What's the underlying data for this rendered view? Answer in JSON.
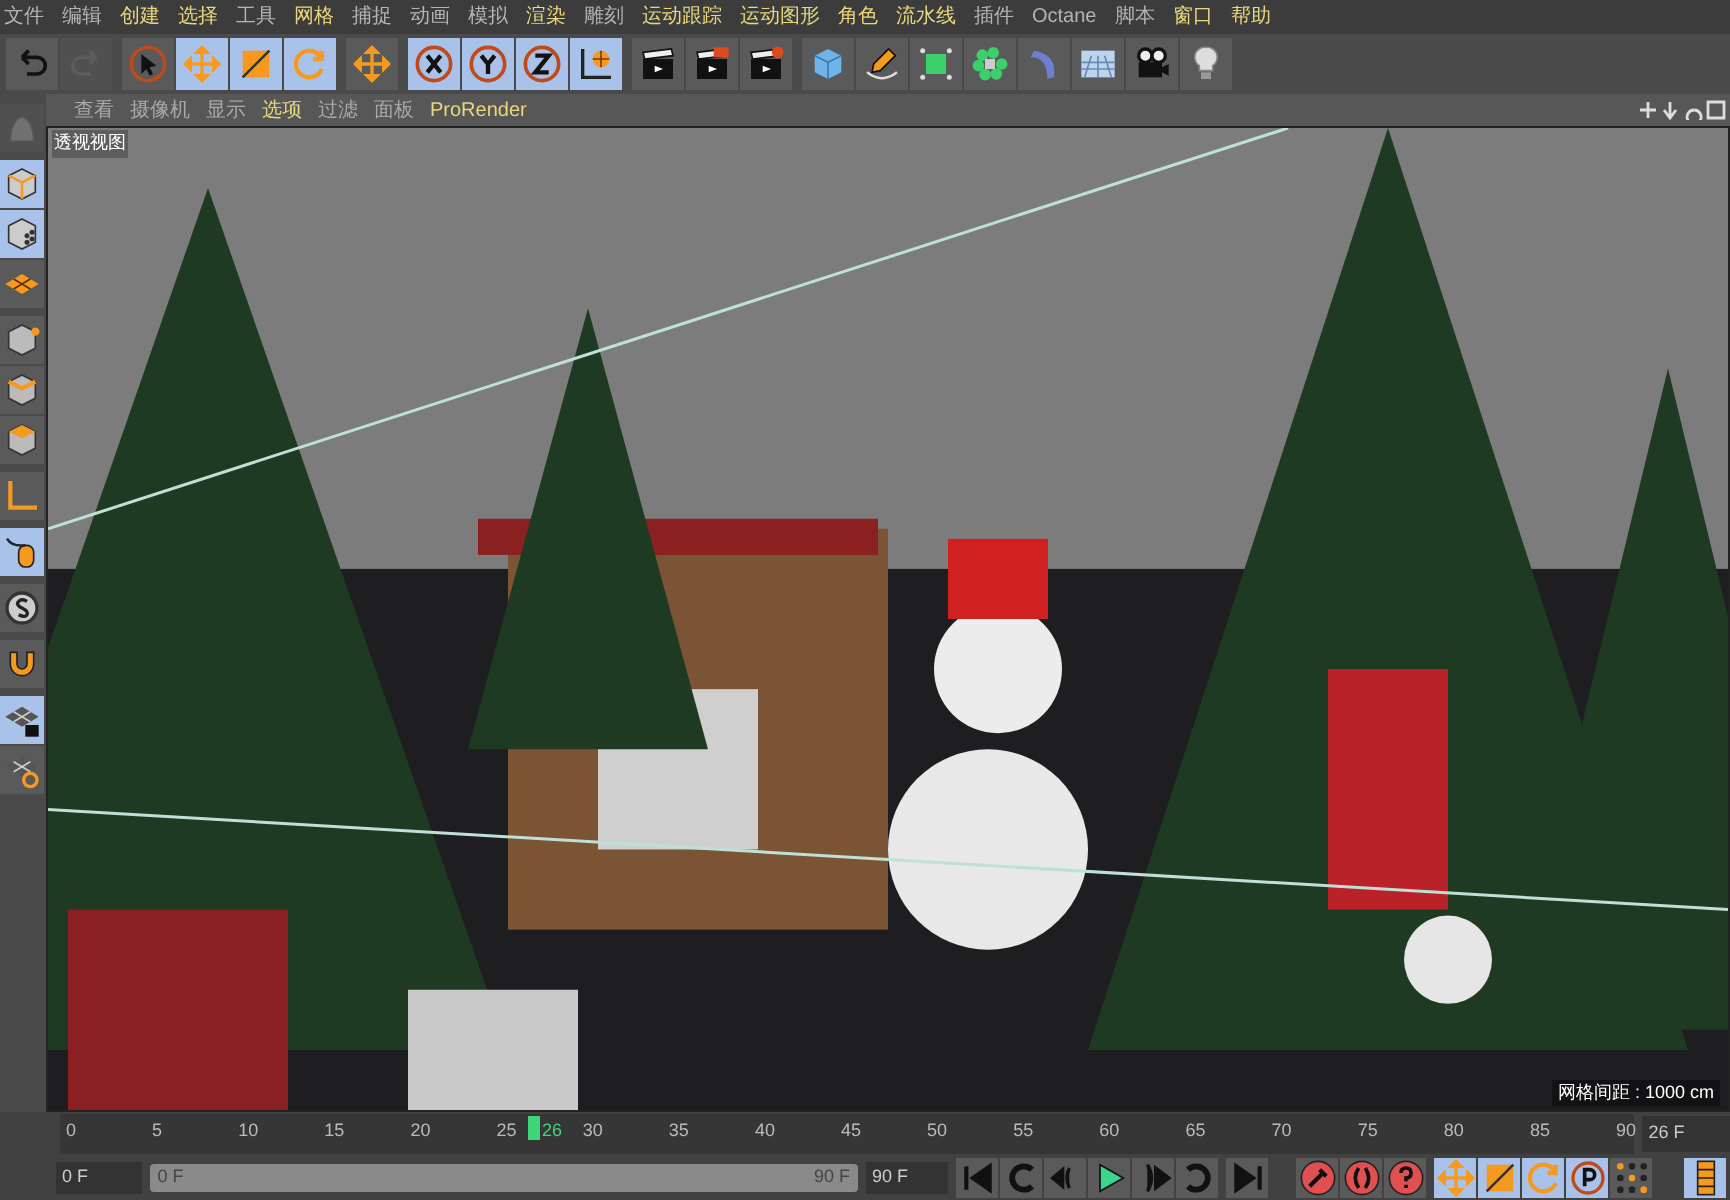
{
  "menu": [
    {
      "label": "文件",
      "highlight": false
    },
    {
      "label": "编辑",
      "highlight": false
    },
    {
      "label": "创建",
      "highlight": true
    },
    {
      "label": "选择",
      "highlight": true
    },
    {
      "label": "工具",
      "highlight": false
    },
    {
      "label": "网格",
      "highlight": true
    },
    {
      "label": "捕捉",
      "highlight": false
    },
    {
      "label": "动画",
      "highlight": false
    },
    {
      "label": "模拟",
      "highlight": false
    },
    {
      "label": "渲染",
      "highlight": true
    },
    {
      "label": "雕刻",
      "highlight": false
    },
    {
      "label": "运动跟踪",
      "highlight": true
    },
    {
      "label": "运动图形",
      "highlight": true
    },
    {
      "label": "角色",
      "highlight": true
    },
    {
      "label": "流水线",
      "highlight": true
    },
    {
      "label": "插件",
      "highlight": false
    },
    {
      "label": "Octane",
      "highlight": false
    },
    {
      "label": "脚本",
      "highlight": false
    },
    {
      "label": "窗口",
      "highlight": true
    },
    {
      "label": "帮助",
      "highlight": true
    }
  ],
  "toolbar": [
    {
      "items": [
        {
          "kind": "undo",
          "selected": false,
          "disabled": false
        },
        {
          "kind": "redo",
          "selected": false,
          "disabled": true
        }
      ]
    },
    {
      "items": [
        {
          "kind": "select",
          "selected": false,
          "disabled": false
        },
        {
          "kind": "move",
          "selected": true,
          "disabled": false
        },
        {
          "kind": "scale",
          "selected": true,
          "disabled": false
        },
        {
          "kind": "rotate",
          "selected": true,
          "disabled": false
        }
      ]
    },
    {
      "items": [
        {
          "kind": "move",
          "selected": false,
          "disabled": false
        }
      ]
    },
    {
      "items": [
        {
          "kind": "x",
          "selected": true,
          "disabled": false
        },
        {
          "kind": "y",
          "selected": true,
          "disabled": false
        },
        {
          "kind": "z",
          "selected": true,
          "disabled": false
        },
        {
          "kind": "coords",
          "selected": true,
          "disabled": false
        }
      ]
    },
    {
      "items": [
        {
          "kind": "render",
          "selected": false,
          "disabled": false
        },
        {
          "kind": "render-view",
          "selected": false,
          "disabled": false
        },
        {
          "kind": "render-settings",
          "selected": false,
          "disabled": false
        }
      ]
    },
    {
      "items": [
        {
          "kind": "cube",
          "selected": false,
          "disabled": false
        },
        {
          "kind": "pen",
          "selected": false,
          "disabled": false
        },
        {
          "kind": "green-cube",
          "selected": false,
          "disabled": false
        },
        {
          "kind": "cloner",
          "selected": false,
          "disabled": false
        },
        {
          "kind": "deformer",
          "selected": false,
          "disabled": false
        },
        {
          "kind": "floor",
          "selected": false,
          "disabled": false
        },
        {
          "kind": "camera",
          "selected": false,
          "disabled": false
        },
        {
          "kind": "light",
          "selected": false,
          "disabled": false
        }
      ]
    }
  ],
  "viewport_menu": [
    {
      "label": "查看",
      "highlight": false
    },
    {
      "label": "摄像机",
      "highlight": false
    },
    {
      "label": "显示",
      "highlight": false
    },
    {
      "label": "选项",
      "highlight": true
    },
    {
      "label": "过滤",
      "highlight": false
    },
    {
      "label": "面板",
      "highlight": false
    },
    {
      "label": "ProRender",
      "highlight": true
    }
  ],
  "left_toolbar": [
    {
      "items": [
        {
          "kind": "model",
          "selected": false,
          "disabled": true
        }
      ]
    },
    {
      "items": [
        {
          "kind": "object",
          "selected": true,
          "disabled": false
        },
        {
          "kind": "texture",
          "selected": true,
          "disabled": false
        },
        {
          "kind": "workplane",
          "selected": false,
          "disabled": false
        }
      ]
    },
    {
      "items": [
        {
          "kind": "points",
          "selected": false,
          "disabled": false
        },
        {
          "kind": "edges",
          "selected": false,
          "disabled": false
        },
        {
          "kind": "polygons",
          "selected": false,
          "disabled": false
        }
      ]
    },
    {
      "items": [
        {
          "kind": "axis",
          "selected": false,
          "disabled": false
        }
      ]
    },
    {
      "items": [
        {
          "kind": "tweak",
          "selected": true,
          "disabled": false
        }
      ]
    },
    {
      "items": [
        {
          "kind": "snap",
          "selected": false,
          "disabled": false
        }
      ]
    },
    {
      "items": [
        {
          "kind": "magnet",
          "selected": false,
          "disabled": false
        }
      ]
    },
    {
      "items": [
        {
          "kind": "grid-lock",
          "selected": true,
          "disabled": false
        },
        {
          "kind": "grid-rotate",
          "selected": false,
          "disabled": false
        }
      ]
    }
  ],
  "viewport": {
    "title": "透视视图",
    "grid_spacing": "网格间距 : 1000 cm"
  },
  "timeline": {
    "ticks": [
      "0",
      "5",
      "10",
      "15",
      "20",
      "25",
      "30",
      "35",
      "40",
      "45",
      "50",
      "55",
      "60",
      "65",
      "70",
      "75",
      "80",
      "85",
      "90"
    ],
    "current": "26",
    "level": 0.289,
    "current_field": "26 F"
  },
  "range": {
    "level": 1,
    "start_field": "0 F",
    "slider_start": "0 F",
    "slider_end": "90 F",
    "end_field": "90 F"
  },
  "transport": [
    {
      "items": [
        {
          "kind": "first",
          "selected": false
        },
        {
          "kind": "prev-key",
          "selected": false
        },
        {
          "kind": "prev-frame",
          "selected": false
        },
        {
          "kind": "play",
          "selected": false
        },
        {
          "kind": "next-frame",
          "selected": false
        },
        {
          "kind": "next-key",
          "selected": false
        }
      ]
    },
    {
      "items": [
        {
          "kind": "last",
          "selected": false
        }
      ]
    },
    {
      "items": [
        {
          "kind": "record",
          "selected": false
        },
        {
          "kind": "autokey",
          "selected": false
        },
        {
          "kind": "keyframe-selection",
          "selected": false
        }
      ]
    },
    {
      "items": [
        {
          "kind": "move",
          "selected": true
        },
        {
          "kind": "scale",
          "selected": true
        },
        {
          "kind": "rotate",
          "selected": true
        },
        {
          "kind": "param",
          "selected": true
        },
        {
          "kind": "dots",
          "selected": false
        }
      ]
    },
    {
      "items": [
        {
          "kind": "timeline",
          "selected": true
        }
      ]
    }
  ]
}
